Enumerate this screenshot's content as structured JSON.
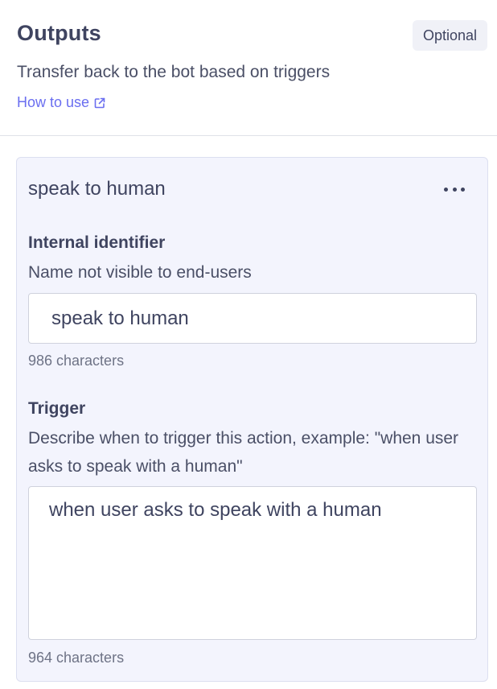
{
  "header": {
    "title": "Outputs",
    "badge": "Optional",
    "subtitle": "Transfer back to the bot based on triggers",
    "link_label": "How to use"
  },
  "card": {
    "title": "speak to human",
    "identifier": {
      "label": "Internal identifier",
      "help": "Name not visible to end-users",
      "value": "speak to human",
      "count": "986 characters"
    },
    "trigger": {
      "label": "Trigger",
      "help": "Describe when to trigger this action, example: \"when user asks to speak with a human\"",
      "value": "when user asks to speak with a human",
      "count": "964 characters"
    }
  },
  "colors": {
    "accent": "#6a6ef0",
    "text": "#3f4460",
    "card_bg": "#f3f4fd",
    "badge_bg": "#f0f1f7"
  },
  "icons": {
    "link": "external-link-icon",
    "menu": "more-horizontal-icon"
  }
}
